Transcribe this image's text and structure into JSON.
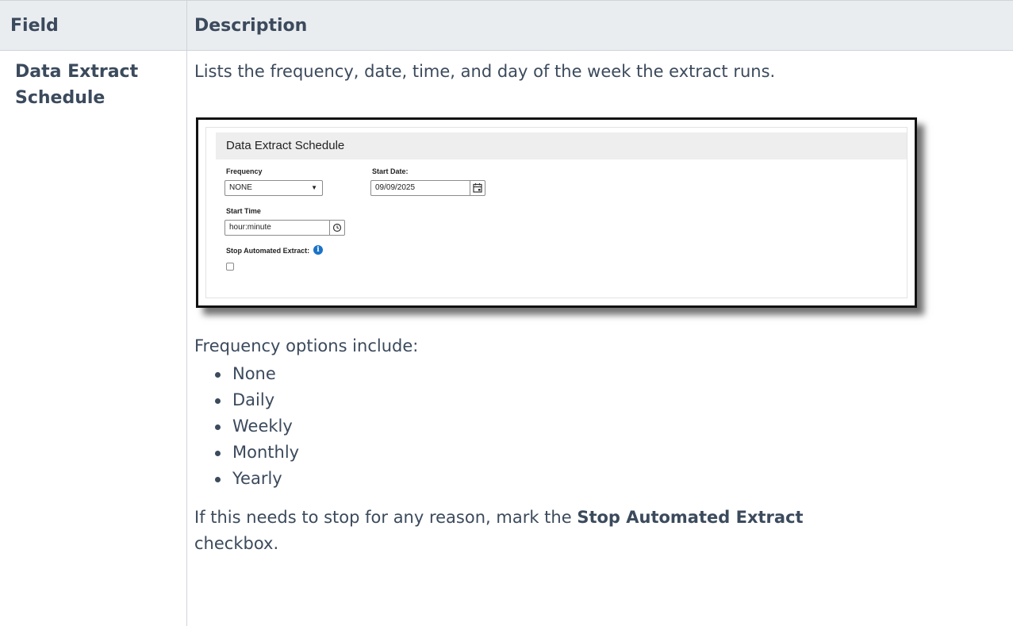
{
  "table": {
    "headers": {
      "field": "Field",
      "description": "Description"
    },
    "row": {
      "field_line1": "Data Extract",
      "field_line2": "Schedule",
      "intro": "Lists the frequency, date, time, and day of the week the extract runs.",
      "screenshot": {
        "title": "Data Extract Schedule",
        "frequency_label": "Frequency",
        "frequency_value": "NONE",
        "start_date_label": "Start Date:",
        "start_date_value": "09/09/2025",
        "start_time_label": "Start Time",
        "start_time_placeholder": "hour:minute",
        "stop_label": "Stop Automated Extract:",
        "stop_checked": false,
        "info_icon_glyph": "i",
        "accent_color": "#1a73c8"
      },
      "frequency_options_intro": "Frequency options include:",
      "frequency_options": [
        "None",
        "Daily",
        "Weekly",
        "Monthly",
        "Yearly"
      ],
      "closing_before": "If this needs to stop for any reason, mark the ",
      "closing_bold": "Stop Automated Extract",
      "closing_after": "checkbox."
    }
  }
}
